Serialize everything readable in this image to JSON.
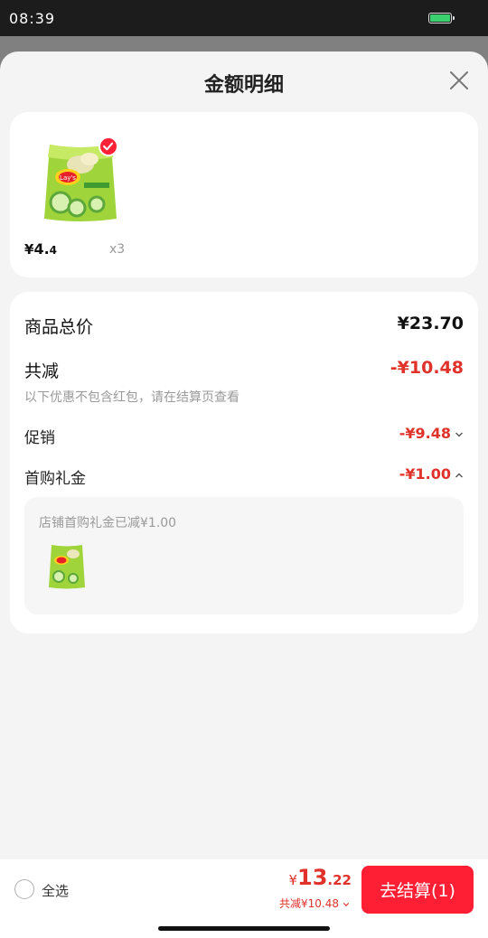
{
  "status_bar": {
    "time": "08:39",
    "battery_level": 1.0
  },
  "sheet": {
    "title": "金额明细"
  },
  "product": {
    "image": "lays-cucumber-chips-bag",
    "selected": true,
    "price_currency": "¥",
    "price_integer": "4.",
    "price_fraction": "4",
    "quantity": "x3"
  },
  "details": {
    "total_label": "商品总价",
    "total_value": "¥23.70",
    "reduce_label": "共减",
    "reduce_value": "-¥10.48",
    "reduce_note": "以下优惠不包含红包，请在结算页查看",
    "promo_label": "促销",
    "promo_value": "-¥9.48",
    "gift_label": "首购礼金",
    "gift_value": "-¥1.00",
    "gift_box_text": "店铺首购礼金已减¥1.00"
  },
  "bottom": {
    "select_all_label": "全选",
    "select_all_checked": false,
    "pay_currency": "¥",
    "pay_integer": "13",
    "pay_fraction": ".22",
    "pay_reduce": "共减¥10.48",
    "checkout_label": "去结算(1)"
  },
  "colors": {
    "accent": "#ff1f35",
    "discount": "#e0322b"
  }
}
